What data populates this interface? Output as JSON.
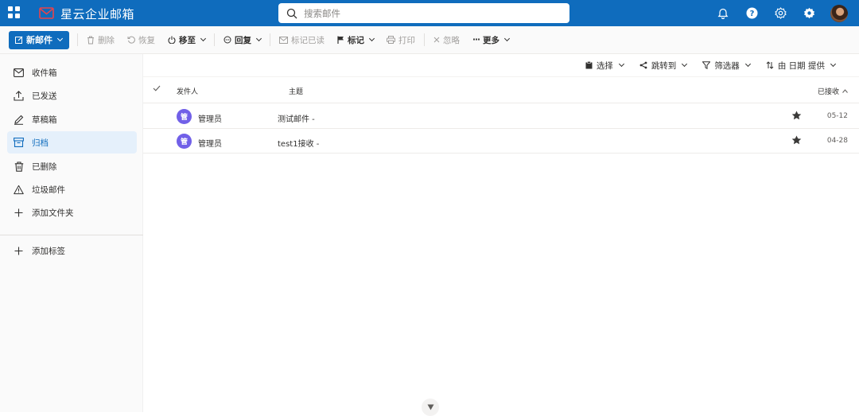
{
  "app": {
    "name": "星云企业邮箱"
  },
  "search": {
    "placeholder": "搜索邮件"
  },
  "toolbar": {
    "new_mail": "新邮件",
    "delete": "删除",
    "restore": "恢复",
    "move_to": "移至",
    "reply": "回复",
    "mark_read": "标记已读",
    "flag": "标记",
    "print": "打印",
    "ignore": "忽略",
    "more": "更多"
  },
  "sidebar": {
    "items": [
      {
        "label": "收件箱",
        "icon": "inbox-icon"
      },
      {
        "label": "已发送",
        "icon": "sent-icon"
      },
      {
        "label": "草稿箱",
        "icon": "draft-pencil-icon"
      },
      {
        "label": "归档",
        "icon": "archive-icon",
        "active": true
      },
      {
        "label": "已删除",
        "icon": "trash-icon"
      },
      {
        "label": "垃圾邮件",
        "icon": "warning-icon"
      },
      {
        "label": "添加文件夹",
        "icon": "plus-icon"
      }
    ],
    "add_label": "添加标签"
  },
  "viewbar": {
    "select": "选择",
    "jump_to": "跳转到",
    "filter": "筛选器",
    "sort": "由 日期 提供"
  },
  "list": {
    "headers": {
      "from": "发件人",
      "subject": "主题",
      "received": "已接收"
    },
    "rows": [
      {
        "avatar": "管",
        "from": "管理员",
        "subject": "测试邮件 -",
        "date": "05-12",
        "flagged": true
      },
      {
        "avatar": "管",
        "from": "管理员",
        "subject": "test1接收 -",
        "date": "04-28",
        "flagged": true
      }
    ]
  },
  "colors": {
    "brand": "#0f6cbd",
    "avatar": "#7160e8",
    "active_bg": "#e5f0fb"
  }
}
